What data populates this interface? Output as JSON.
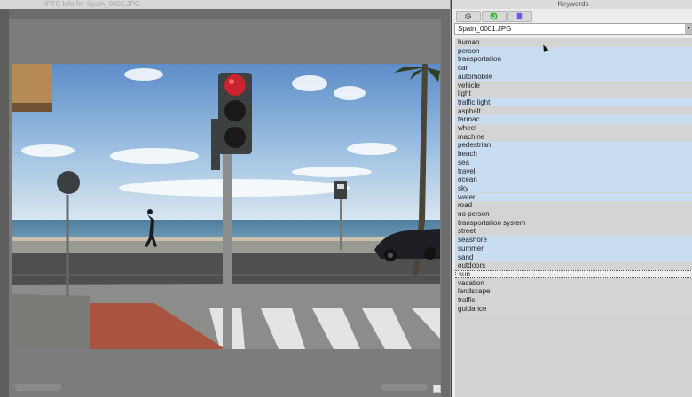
{
  "left_window": {
    "title": "IPTC Info for Spain_0001.JPG"
  },
  "keywords_panel": {
    "title": "Keywords",
    "title_extra": "",
    "toolbar": [
      {
        "name": "gear-button",
        "icon": "gear-icon",
        "color": "#444444"
      },
      {
        "name": "refresh-button",
        "icon": "refresh-icon",
        "color": "#3cb43c"
      },
      {
        "name": "bookmark-button",
        "icon": "bookmark-icon",
        "color": "#6b5cd6"
      }
    ],
    "file_select": {
      "value": "Spain_0001.JPG"
    },
    "keywords": [
      {
        "label": "human",
        "selected": false
      },
      {
        "label": "person",
        "selected": true
      },
      {
        "label": "transportation",
        "selected": true
      },
      {
        "label": "car",
        "selected": true
      },
      {
        "label": "automobile",
        "selected": true
      },
      {
        "label": "vehicle",
        "selected": false
      },
      {
        "label": "light",
        "selected": false
      },
      {
        "label": "traffic light",
        "selected": true
      },
      {
        "label": "asphalt",
        "selected": false
      },
      {
        "label": "tarmac",
        "selected": true
      },
      {
        "label": "wheel",
        "selected": false
      },
      {
        "label": "machine",
        "selected": false
      },
      {
        "label": "pedestrian",
        "selected": true
      },
      {
        "label": "beach",
        "selected": true
      },
      {
        "label": "sea",
        "selected": true
      },
      {
        "label": "travel",
        "selected": true
      },
      {
        "label": "ocean",
        "selected": true
      },
      {
        "label": "sky",
        "selected": true
      },
      {
        "label": "water",
        "selected": true
      },
      {
        "label": "road",
        "selected": false
      },
      {
        "label": "no person",
        "selected": false
      },
      {
        "label": "transportation system",
        "selected": false
      },
      {
        "label": "street",
        "selected": false
      },
      {
        "label": "seashore",
        "selected": true
      },
      {
        "label": "summer",
        "selected": true
      },
      {
        "label": "sand",
        "selected": true
      },
      {
        "label": "outdoors",
        "selected": false
      },
      {
        "label": "sun",
        "selected": false,
        "focused": true
      },
      {
        "label": "vacation",
        "selected": false
      },
      {
        "label": "landscape",
        "selected": false
      },
      {
        "label": "traffic",
        "selected": false
      },
      {
        "label": "guidance",
        "selected": false
      }
    ]
  },
  "colors": {
    "selected_row": "#c8ddf2",
    "unselected_row": "#d4d4d4"
  }
}
